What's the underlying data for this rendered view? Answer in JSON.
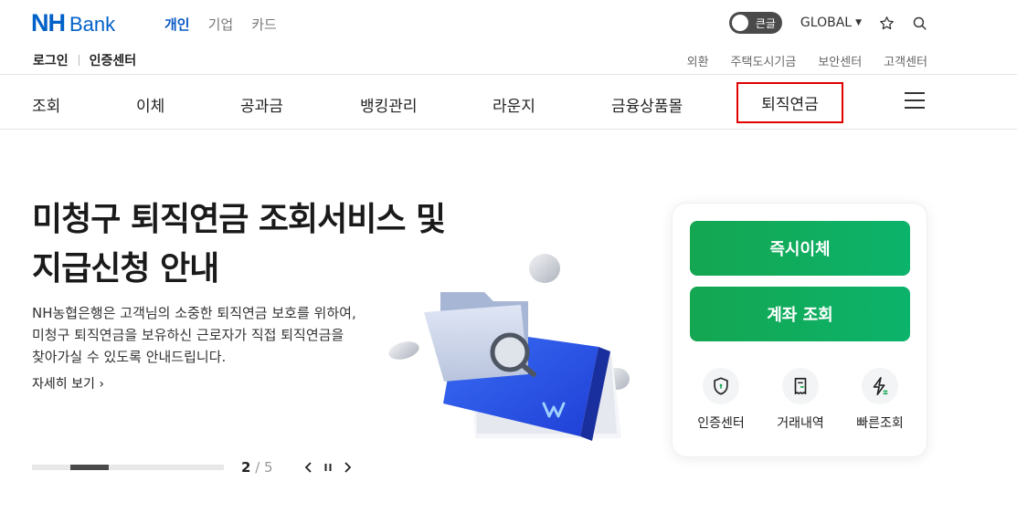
{
  "header": {
    "logo_nh": "NH",
    "logo_bank": "Bank",
    "biz_tabs": [
      {
        "label": "개인",
        "active": true
      },
      {
        "label": "기업",
        "active": false
      },
      {
        "label": "카드",
        "active": false
      }
    ],
    "large_text_toggle": "큰글",
    "global_label": "GLOBAL",
    "login_label": "로그인",
    "cert_center_label": "인증센터",
    "util_links": [
      "외환",
      "주택도시기금",
      "보안센터",
      "고객센터"
    ]
  },
  "nav": {
    "items": [
      "조회",
      "이체",
      "공과금",
      "뱅킹관리",
      "라운지",
      "금융상품몰",
      "퇴직연금"
    ]
  },
  "hero": {
    "title_line1": "미청구 퇴직연금 조회서비스 및",
    "title_line2": "지급신청 안내",
    "desc_line1": "NH농협은행은 고객님의 소중한 퇴직연금 보호를 위하여,",
    "desc_line2": "미청구 퇴직연금을 보유하신 근로자가 직접 퇴직연금을",
    "desc_line3": "찾아가실 수 있도록 안내드립니다.",
    "more_label": "자세히 보기",
    "current_page": "2",
    "total_pages": "/ 5"
  },
  "quick": {
    "btn_transfer": "즉시이체",
    "btn_account": "계좌 조회",
    "icons": [
      {
        "label": "인증센터",
        "icon": "shield-icon"
      },
      {
        "label": "거래내역",
        "icon": "receipt-icon"
      },
      {
        "label": "빠른조회",
        "icon": "lightning-icon"
      }
    ]
  },
  "colors": {
    "brand_blue": "#0061c8",
    "accent_green": "#14a651",
    "highlight_red": "#e00000"
  }
}
